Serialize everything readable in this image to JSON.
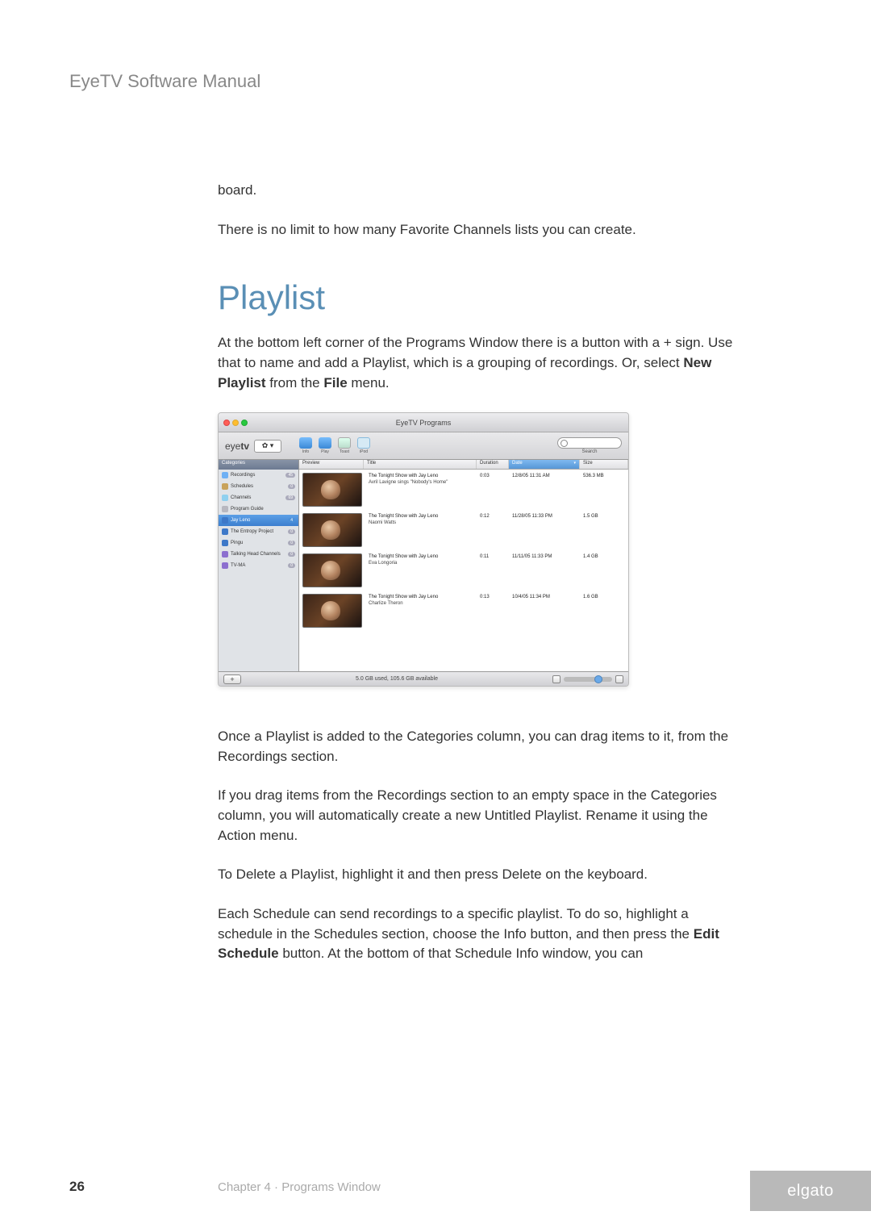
{
  "header": "EyeTV Software Manual",
  "intro": {
    "p1": "board.",
    "p2": "There is no limit to how many Favorite Channels lists you can create."
  },
  "section_title": "Playlist",
  "p3_a": "At the bottom left corner of the Programs Window there is a button with a + sign.  Use that to name and add a Playlist, which is a grouping of recordings.  Or, select ",
  "p3_b": "New Playlist",
  "p3_c": " from the ",
  "p3_d": "File",
  "p3_e": " menu.",
  "screenshot": {
    "window_title": "EyeTV Programs",
    "logo_a": "eye",
    "logo_b": "tv",
    "gear": "✿ ▾",
    "tool_labels": [
      "Info",
      "Play",
      "Toast",
      "iPod"
    ],
    "search_label": "Search",
    "sidebar": {
      "header": "Categories",
      "items": [
        {
          "label": "Recordings",
          "count": "45",
          "icon": "#6eb0f4"
        },
        {
          "label": "Schedules",
          "count": "0",
          "icon": "#c8a25a"
        },
        {
          "label": "Channels",
          "count": "69",
          "icon": "#8fd0ef"
        },
        {
          "label": "Program Guide",
          "count": "",
          "icon": "#b8b8c0"
        },
        {
          "label": "Jay Leno",
          "count": "4",
          "icon": "#3d78c8",
          "selected": true
        },
        {
          "label": "The Entropy Project",
          "count": "0",
          "icon": "#3d78c8"
        },
        {
          "label": "Pingu",
          "count": "0",
          "icon": "#3d78c8"
        },
        {
          "label": "Talking Head Channels",
          "count": "0",
          "icon": "#8c6fcf"
        },
        {
          "label": "TV-MA",
          "count": "0",
          "icon": "#8c6fcf"
        }
      ]
    },
    "columns": [
      "Preview",
      "Title",
      "Duration",
      "Date",
      "Size"
    ],
    "rows": [
      {
        "title": "The Tonight Show with Jay Leno",
        "sub": "Avril Lavigne sings \"Nobody's Home\"",
        "dur": "0:03",
        "date": "12/8/05 11:31 AM",
        "size": "536.3 MB"
      },
      {
        "title": "The Tonight Show with Jay Leno",
        "sub": "Naomi Watts",
        "dur": "0:12",
        "date": "11/28/05 11:33 PM",
        "size": "1.5 GB"
      },
      {
        "title": "The Tonight Show with Jay Leno",
        "sub": "Eva Longoria",
        "dur": "0:11",
        "date": "11/11/05 11:33 PM",
        "size": "1.4 GB"
      },
      {
        "title": "The Tonight Show with Jay Leno",
        "sub": "Charlize Theron",
        "dur": "0:13",
        "date": "10/4/05 11:34 PM",
        "size": "1.6 GB"
      }
    ],
    "footer_status": "5.0 GB used, 105.6 GB available",
    "plus": "+"
  },
  "p4": "Once a Playlist is added to the Categories column, you can drag items to it, from the Recordings section.",
  "p5": "If you drag items from the Recordings section to an empty space in the Catego­ries column, you will automatically create a new Untitled Playlist. Rename it using the Action menu.",
  "p6": "To Delete a Playlist, highlight it and then press Delete on the keyboard.",
  "p7_a": "Each Schedule can send recordings to a specific playlist.  To do so, highlight a schedule in the Schedules section, choose the Info button, and then press the ",
  "p7_b": "Edit Schedule",
  "p7_c": " button.  At the bottom of that Schedule Info window, you can",
  "footer": {
    "page": "26",
    "chapter": "Chapter 4 · Programs Window",
    "brand": "elgato"
  }
}
